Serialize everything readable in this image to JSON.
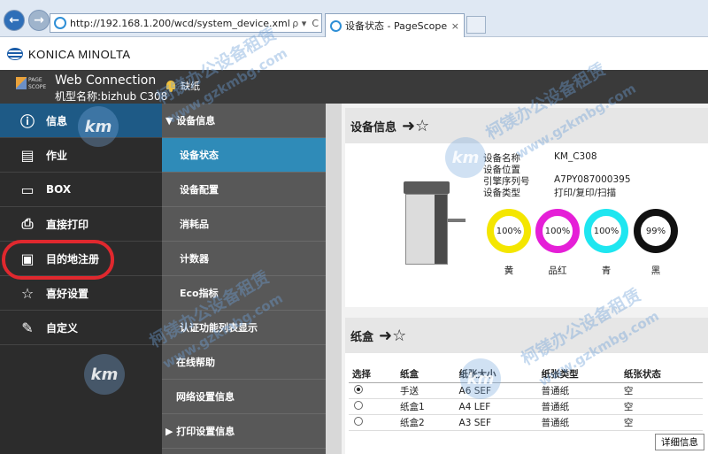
{
  "browser": {
    "url": "http://192.168.1.200/wcd/system_device.xml",
    "tab_title": "设备状态 - PageScope W...",
    "tab_close": "×",
    "addr_search": "ρ ▾",
    "addr_refresh": "C",
    "back_icon": "←",
    "forward_icon": "→"
  },
  "brand": {
    "name": "KONICA MINOLTA"
  },
  "header": {
    "logo_line1": "PAGE",
    "logo_line2": "SCOPE",
    "title": "Web Connection",
    "model": "机型名称:bizhub C308",
    "alert": "缺纸"
  },
  "left_nav": [
    {
      "label": "信息",
      "icon": "info-icon",
      "active": true
    },
    {
      "label": "作业",
      "icon": "job-icon"
    },
    {
      "label": "BOX",
      "icon": "box-icon"
    },
    {
      "label": "直接打印",
      "icon": "direct-print-icon"
    },
    {
      "label": "目的地注册",
      "icon": "address-book-icon"
    },
    {
      "label": "喜好设置",
      "icon": "favorite-icon"
    },
    {
      "label": "自定义",
      "icon": "customize-icon"
    }
  ],
  "sub_nav": [
    {
      "label": "▼ 设备信息",
      "group": true
    },
    {
      "label": "设备状态",
      "active": true
    },
    {
      "label": "设备配置"
    },
    {
      "label": "消耗品"
    },
    {
      "label": "计数器"
    },
    {
      "label": "Eco指标"
    },
    {
      "label": "认证功能列表显示"
    },
    {
      "label": "在线帮助"
    },
    {
      "label": "网络设置信息"
    },
    {
      "label": "▶ 打印设置信息",
      "group": true
    }
  ],
  "device_info": {
    "heading": "设备信息",
    "rows": [
      {
        "label": "设备名称",
        "value": "KM_C308"
      },
      {
        "label": "设备位置",
        "value": ""
      },
      {
        "label": "引擎序列号",
        "value": "A7PY087000395"
      },
      {
        "label": "设备类型",
        "value": "打印/复印/扫描"
      }
    ],
    "toners": [
      {
        "name": "黄",
        "level": "100%",
        "color": "#f4e600"
      },
      {
        "name": "品红",
        "level": "100%",
        "color": "#e51fd7"
      },
      {
        "name": "青",
        "level": "100%",
        "color": "#1ee6f0"
      },
      {
        "name": "黑",
        "level": "99%",
        "color": "#111111"
      }
    ]
  },
  "tray": {
    "heading": "纸盒",
    "columns": [
      "选择",
      "纸盒",
      "纸张大小",
      "纸张类型",
      "纸张状态"
    ],
    "rows": [
      {
        "selected": true,
        "tray": "手送",
        "size": "A6 SEF",
        "type": "普通纸",
        "status": "空"
      },
      {
        "selected": false,
        "tray": "纸盒1",
        "size": "A4 LEF",
        "type": "普通纸",
        "status": "空"
      },
      {
        "selected": false,
        "tray": "纸盒2",
        "size": "A3 SEF",
        "type": "普通纸",
        "status": "空"
      }
    ],
    "detail_button": "详细信息"
  },
  "watermark": {
    "logo": "km",
    "text": "柯镁办公设备租赁",
    "url": "www.gzkmbg.com"
  }
}
